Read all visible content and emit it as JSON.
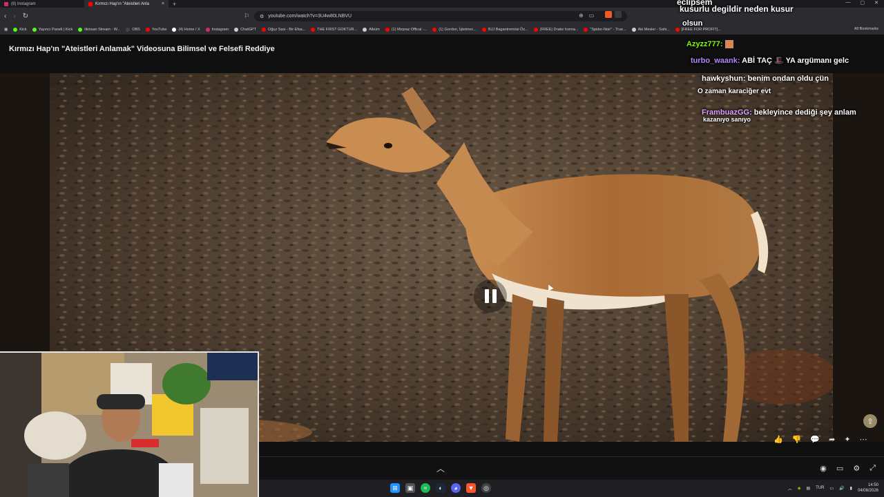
{
  "browser": {
    "tabs": [
      {
        "label": "(8) Instagram",
        "color": "#d62976",
        "active": false
      },
      {
        "label": "Kırmızı Hap'ın \"Ateistleri Anla",
        "color": "#ff0000",
        "active": true
      }
    ],
    "url": "youtube.com/watch?v=3U4w80LNBVU",
    "bookmarks": [
      {
        "label": "Kick",
        "color": "#53fc18"
      },
      {
        "label": "Yayıncı Paneli | Kick",
        "color": "#53fc18"
      },
      {
        "label": "ilkinsan Stream - W...",
        "color": "#53fc18"
      },
      {
        "label": "OBS",
        "color": "#444444"
      },
      {
        "label": "YouTube",
        "color": "#ff0000"
      },
      {
        "label": "(4) Home / X",
        "color": "#ffffff"
      },
      {
        "label": "Instagram",
        "color": "#d62976"
      },
      {
        "label": "ChatGPT",
        "color": "#cccccc"
      },
      {
        "label": "Oğuz Sasi - Bir Efsa...",
        "color": "#ff0000"
      },
      {
        "label": "THE FIRST GOKTUR...",
        "color": "#ff0000"
      },
      {
        "label": "Albüm",
        "color": "#cccccc"
      },
      {
        "label": "(1) Mepraz Offical -...",
        "color": "#ff0000"
      },
      {
        "label": "(1) Gordon, İşletmec...",
        "color": "#ff0000"
      },
      {
        "label": "BJJ Bagantremösi Öz...",
        "color": "#ff0000"
      },
      {
        "label": "(FREE) Drake Icema...",
        "color": "#ff0000"
      },
      {
        "label": "\"Spider-Noir\" - True...",
        "color": "#ff0000"
      },
      {
        "label": "Aki Mesler - Sahi...",
        "color": "#cccccc"
      },
      {
        "label": "[FREE FOR PROFIT]...",
        "color": "#ff0000"
      }
    ],
    "all_bookmarks": "All Bookmarks"
  },
  "video": {
    "title": "Kırmızı Hap'ın \"Ateistleri Anlamak\" Videosuna Bilimsel ve Felsefi Reddiye",
    "state": "playing"
  },
  "chat": [
    {
      "user": "eclipsem",
      "text": "kusurlu degildir neden kusur",
      "user_color": "#ffffff"
    },
    {
      "user": "",
      "text": "olsun",
      "user_color": "#ffffff"
    },
    {
      "user": "Azyzz777:",
      "text": "",
      "user_color": "#7cfc00"
    },
    {
      "user": "turbo_waank:",
      "text": "ABİ TAÇ 🎩 YA argümanı gelc",
      "user_color": "#b388ff"
    },
    {
      "user": "hawkyshun:",
      "text": "benim ondan oldu çün",
      "user_color": "#ffffff"
    },
    {
      "user": "",
      "text": "O zaman karaciğer evt",
      "user_color": "#ffffff"
    },
    {
      "user": "FrambuazGG:",
      "text": "bekleyince dediği şey anlam",
      "user_color": "#d9a0ff"
    },
    {
      "user": "",
      "text": "kazanıyo sanıyo",
      "user_color": "#ffffff"
    }
  ],
  "taskbar": {
    "language": "TUR",
    "time": "14:50",
    "date": "04/08/2026"
  }
}
